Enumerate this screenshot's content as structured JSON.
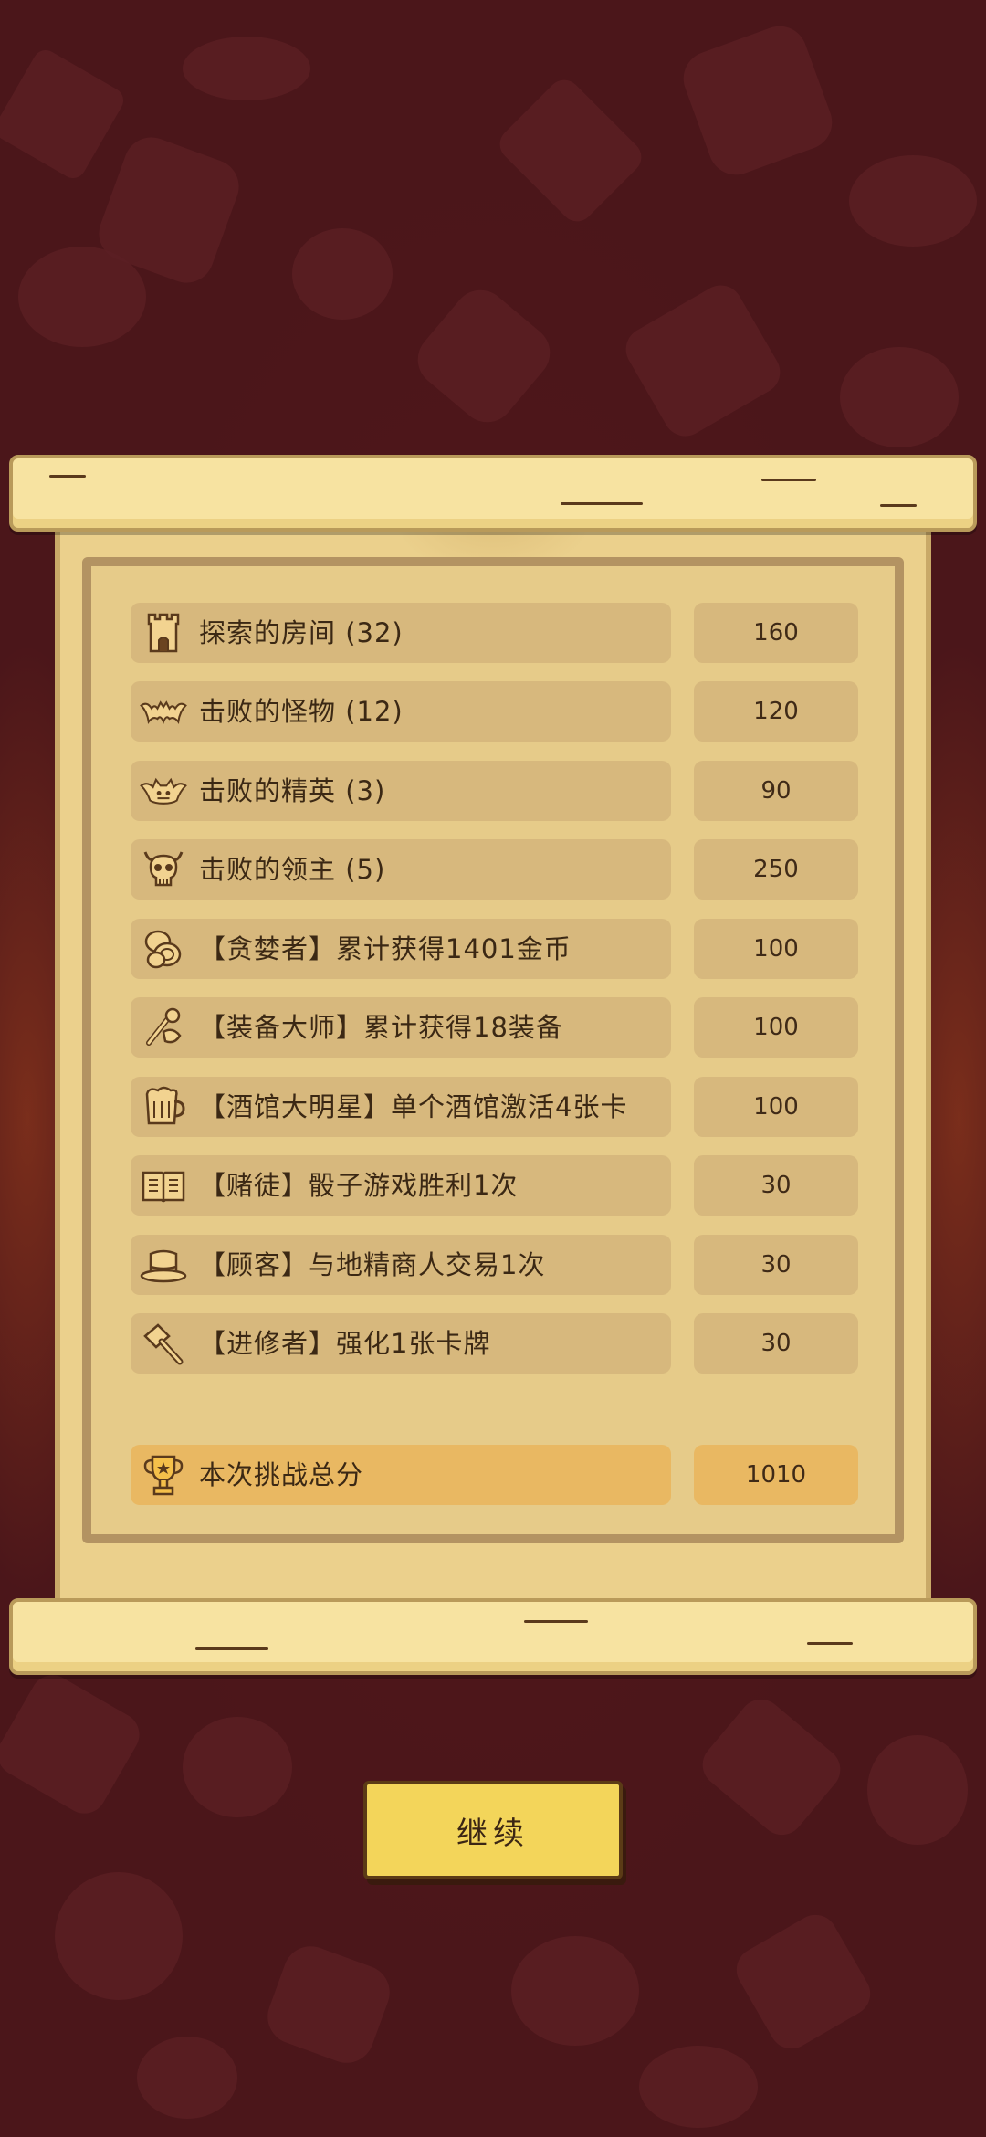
{
  "stats": [
    {
      "icon": "tower-icon",
      "label": "探索的房间 (32)",
      "value": "160"
    },
    {
      "icon": "bat-icon",
      "label": "击败的怪物 (12)",
      "value": "120"
    },
    {
      "icon": "elite-demon-icon",
      "label": "击败的精英 (3)",
      "value": "90"
    },
    {
      "icon": "boss-skull-icon",
      "label": "击败的领主 (5)",
      "value": "250"
    },
    {
      "icon": "coins-icon",
      "label": "【贪婪者】累计获得1401金币",
      "value": "100"
    },
    {
      "icon": "equipment-icon",
      "label": "【装备大师】累计获得18装备",
      "value": "100"
    },
    {
      "icon": "beer-mug-icon",
      "label": "【酒馆大明星】单个酒馆激活4张卡",
      "value": "100"
    },
    {
      "icon": "book-icon",
      "label": "【赌徒】骰子游戏胜利1次",
      "value": "30"
    },
    {
      "icon": "top-hat-icon",
      "label": "【顾客】与地精商人交易1次",
      "value": "30"
    },
    {
      "icon": "hammer-icon",
      "label": "【进修者】强化1张卡牌",
      "value": "30"
    }
  ],
  "total": {
    "icon": "trophy-icon",
    "label": "本次挑战总分",
    "value": "1010"
  },
  "continue_label": "继续",
  "colors": {
    "background": "#4b161a",
    "parchment": "#ebd08c",
    "pill": "#d7b87d",
    "total_pill": "#e9b862",
    "button": "#f3d55a"
  }
}
